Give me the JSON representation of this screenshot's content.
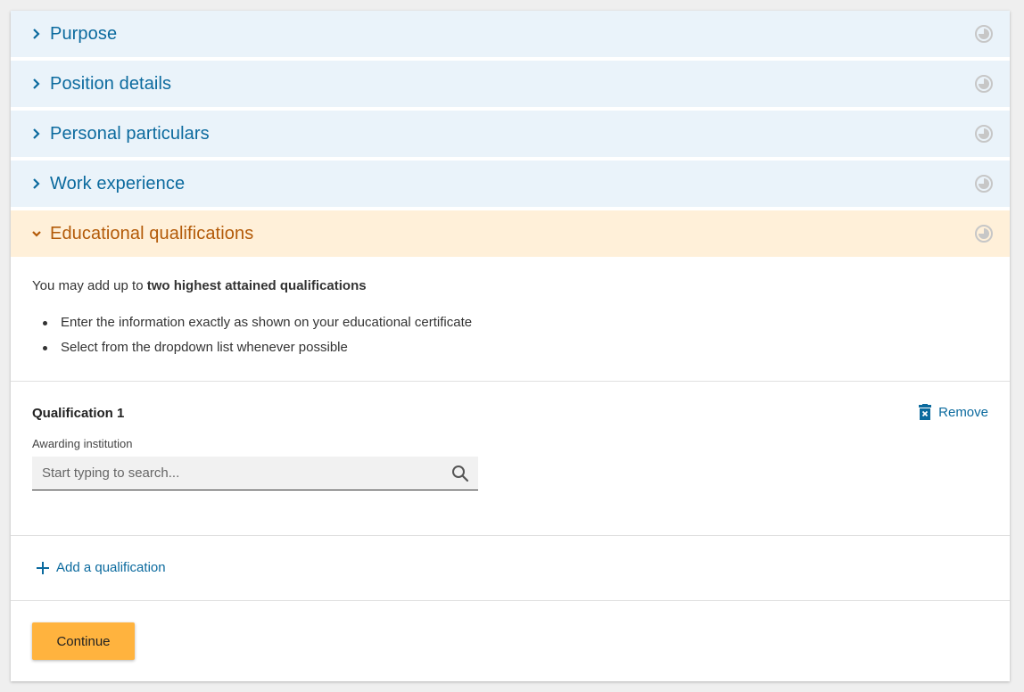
{
  "sections": [
    {
      "label": "Purpose",
      "state": "collapsed"
    },
    {
      "label": "Position details",
      "state": "collapsed"
    },
    {
      "label": "Personal particulars",
      "state": "collapsed"
    },
    {
      "label": "Work experience",
      "state": "collapsed"
    },
    {
      "label": "Educational qualifications",
      "state": "expanded"
    }
  ],
  "education": {
    "intro_prefix": "You may add up to ",
    "intro_bold": "two highest attained qualifications",
    "bullets": [
      "Enter the information exactly as shown on your educational certificate",
      "Select from the dropdown list whenever possible"
    ],
    "qualification": {
      "title": "Qualification 1",
      "remove_label": "Remove",
      "field_label": "Awarding institution",
      "search_placeholder": "Start typing to search...",
      "search_value": ""
    },
    "add_label": "Add a qualification",
    "continue_label": "Continue"
  },
  "icons": {
    "collapsed_chevron": "chevron-right-icon",
    "expanded_chevron": "chevron-down-icon",
    "status": "progress-circle-icon",
    "remove": "trash-icon",
    "search": "search-icon",
    "add": "plus-icon"
  },
  "colors": {
    "link_blue": "#0b6a9e",
    "active_orange": "#b35a08",
    "collapsed_bg": "#eaf3fa",
    "active_bg": "#fff0d9",
    "continue_bg": "#ffb33e"
  }
}
